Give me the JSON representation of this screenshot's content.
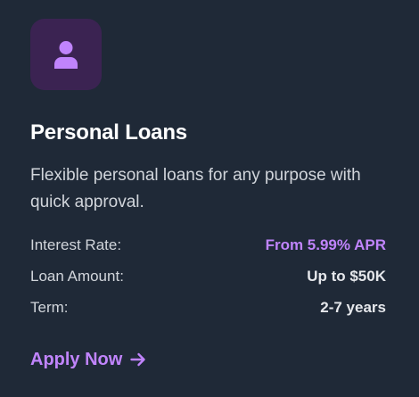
{
  "card": {
    "icon": "user-icon",
    "title": "Personal Loans",
    "description": "Flexible personal loans for any purpose with quick approval.",
    "details": [
      {
        "label": "Interest Rate:",
        "value": "From 5.99% APR"
      },
      {
        "label": "Loan Amount:",
        "value": "Up to $50K"
      },
      {
        "label": "Term:",
        "value": "2-7 years"
      }
    ],
    "cta": {
      "label": "Apply Now",
      "icon": "arrow-right-icon"
    }
  },
  "colors": {
    "background": "#1f2937",
    "icon_tile": "#3b2352",
    "accent": "#c084fc"
  }
}
